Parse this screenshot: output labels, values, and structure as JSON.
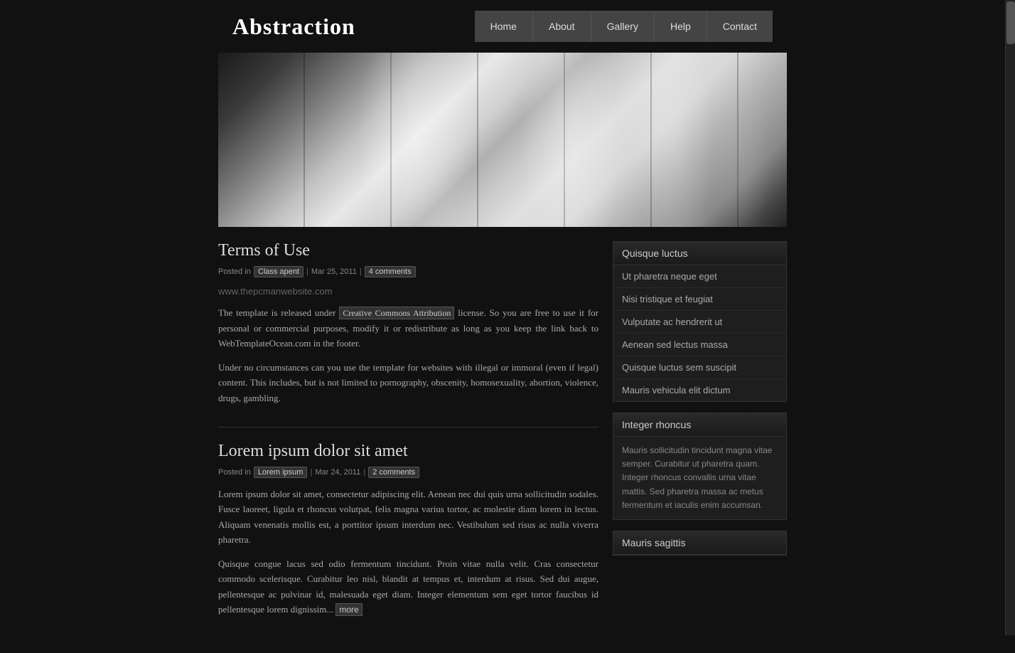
{
  "site": {
    "title": "Abstraction"
  },
  "nav": {
    "items": [
      {
        "label": "Home",
        "href": "#"
      },
      {
        "label": "About",
        "href": "#"
      },
      {
        "label": "Gallery",
        "href": "#"
      },
      {
        "label": "Help",
        "href": "#"
      },
      {
        "label": "Contact",
        "href": "#"
      }
    ]
  },
  "post1": {
    "title": "Terms of Use",
    "meta_prefix": "Posted in",
    "category": "Class apent",
    "date": "Mar 25, 2011",
    "comments": "4 comments",
    "watermark": "www.thepcmanwebsite.com",
    "body1": "The template is released under",
    "link_text": "Creative Commons Attribution",
    "body1_cont": "license. So you are free to use it for personal or commercial purposes, modify it or redistribute as long as you keep the link back to WebTemplateOcean.com in the footer.",
    "body2": "Under no circumstances can you use the template for websites with illegal or immoral (even if legal) content. This includes, but is not limited to pornography, obscenity, homosexuality, abortion, violence, drugs, gambling."
  },
  "post2": {
    "title": "Lorem ipsum dolor sit amet",
    "meta_prefix": "Posted in",
    "category": "Lorem ipsum",
    "date": "Mar 24, 2011",
    "comments": "2 comments",
    "body1": "Lorem ipsum dolor sit amet, consectetur adipiscing elit. Aenean nec dui quis urna sollicitudin sodales. Fusce laoreet, ligula et rhoncus volutpat, felis magna varius tortor, ac molestie diam lorem in lectus. Aliquam venenatis mollis est, a porttitor ipsum interdum nec. Vestibulum sed risus ac nulla viverra pharetra.",
    "body2_prefix": "Quisque congue lacus sed odio fermentum tincidunt. Proin vitae nulla velit. Cras consectetur commodo scelerisque. Curabitur leo nisl, blandit at tempus et, interdum at risus. Sed dui augue, pellentesque ac pulvinar id, malesuada eget diam. Integer elementum sem eget tortor faucibus id pellentesque lorem dignissim...",
    "more_link": "more"
  },
  "sidebar": {
    "widget1": {
      "title": "Quisque luctus",
      "items": [
        "Ut pharetra neque eget",
        "Nisi tristique et feugiat",
        "Vulputate ac hendrerit ut",
        "Aenean sed lectus massa",
        "Quisque luctus sem suscipit",
        "Mauris vehicula elit dictum"
      ]
    },
    "widget2": {
      "title": "Integer rhoncus",
      "body": "Mauris sollicitudin tincidunt magna vitae semper. Curabitur ut pharetra quam. Integer rhoncus convallis urna vitae mattis. Sed pharetra massa ac metus fermentum et iaculis enim accumsan."
    },
    "widget3": {
      "title": "Mauris sagittis"
    }
  }
}
